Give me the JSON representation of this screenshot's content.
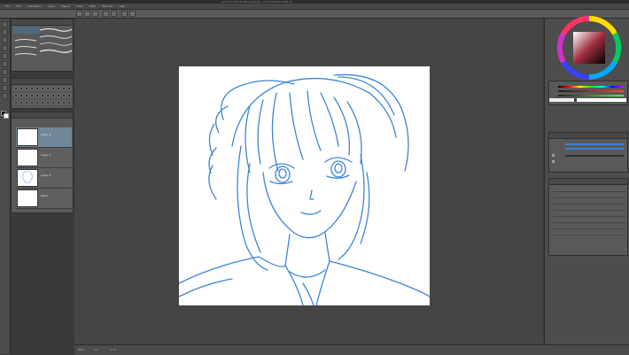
{
  "app": {
    "title": "[CLIP STUDIO PAINT] [Sketch] - CLIP STUDIO PAINT EX"
  },
  "menu": {
    "items": [
      "File",
      "Edit",
      "Animation",
      "Layer",
      "Select",
      "View",
      "Filter",
      "Window",
      "Help"
    ]
  },
  "statusbar": {
    "zoom": "88.8",
    "angle": "0.0",
    "coords": "0 / 0"
  },
  "layers": {
    "items": [
      {
        "name": "Layer 4"
      },
      {
        "name": "Layer 3"
      },
      {
        "name": "Layer 2"
      },
      {
        "name": "Paper"
      }
    ]
  },
  "colors": {
    "line": "#3d86d8",
    "paper": "#ffffff",
    "workspace": "#454545",
    "accent_selected": "#6f8796",
    "slider_blue": "#3a7fd6"
  },
  "icons": [
    "brush-icon",
    "pen-icon",
    "eraser-icon",
    "fill-icon",
    "select-icon",
    "move-icon",
    "text-icon",
    "eyedropper-icon",
    "hand-icon",
    "zoom-icon"
  ]
}
